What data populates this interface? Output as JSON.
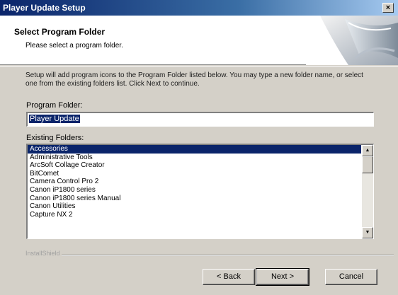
{
  "window": {
    "title": "Player Update Setup",
    "close_glyph": "×"
  },
  "header": {
    "title": "Select Program Folder",
    "subtitle": "Please select a program folder."
  },
  "description": "Setup will add program icons to the Program Folder listed below. You may type a new folder name, or select one from the existing folders list. Click Next to continue.",
  "program_folder": {
    "label": "Program Folder:",
    "value": "Player Update"
  },
  "existing_folders": {
    "label": "Existing Folders:",
    "items": [
      "Accessories",
      "Administrative Tools",
      "ArcSoft Collage Creator",
      "BitComet",
      "Camera Control Pro 2",
      "Canon iP1800 series",
      "Canon iP1800 series Manual",
      "Canon Utilities",
      "Capture NX 2"
    ],
    "selected_index": 0
  },
  "separator_label": "InstallShield",
  "buttons": {
    "back": "< Back",
    "next": "Next >",
    "cancel": "Cancel"
  },
  "icons": {
    "scroll_up": "scroll-up-arrow-icon",
    "scroll_down": "scroll-down-arrow-icon"
  },
  "colors": {
    "title_bar": "#0a246a",
    "selection": "#0a246a",
    "face": "#d4d0c8"
  }
}
